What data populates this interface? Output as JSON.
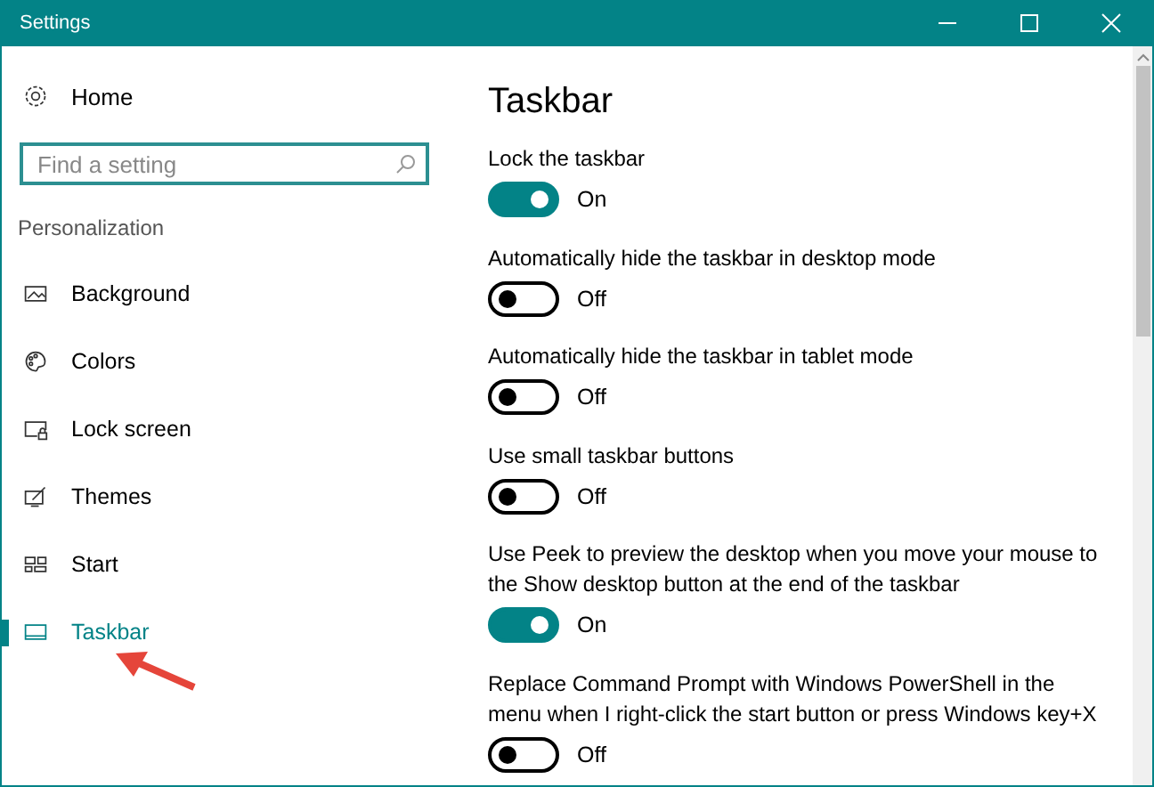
{
  "window": {
    "title": "Settings"
  },
  "sidebar": {
    "home": "Home",
    "search": {
      "placeholder": "Find a setting"
    },
    "section": "Personalization",
    "items": [
      {
        "label": "Background",
        "selected": false
      },
      {
        "label": "Colors",
        "selected": false
      },
      {
        "label": "Lock screen",
        "selected": false
      },
      {
        "label": "Themes",
        "selected": false
      },
      {
        "label": "Start",
        "selected": false
      },
      {
        "label": "Taskbar",
        "selected": true
      }
    ]
  },
  "page": {
    "title": "Taskbar",
    "settings": [
      {
        "label": "Lock the taskbar",
        "on": true,
        "state_text": "On"
      },
      {
        "label": "Automatically hide the taskbar in desktop mode",
        "on": false,
        "state_text": "Off"
      },
      {
        "label": "Automatically hide the taskbar in tablet mode",
        "on": false,
        "state_text": "Off"
      },
      {
        "label": "Use small taskbar buttons",
        "on": false,
        "state_text": "Off"
      },
      {
        "label": "Use Peek to preview the desktop when you move your mouse to the Show desktop button at the end of the taskbar",
        "on": true,
        "state_text": "On"
      },
      {
        "label": "Replace Command Prompt with Windows PowerShell in the menu when I right-click the start button or press Windows key+X",
        "on": false,
        "state_text": "Off"
      }
    ]
  }
}
